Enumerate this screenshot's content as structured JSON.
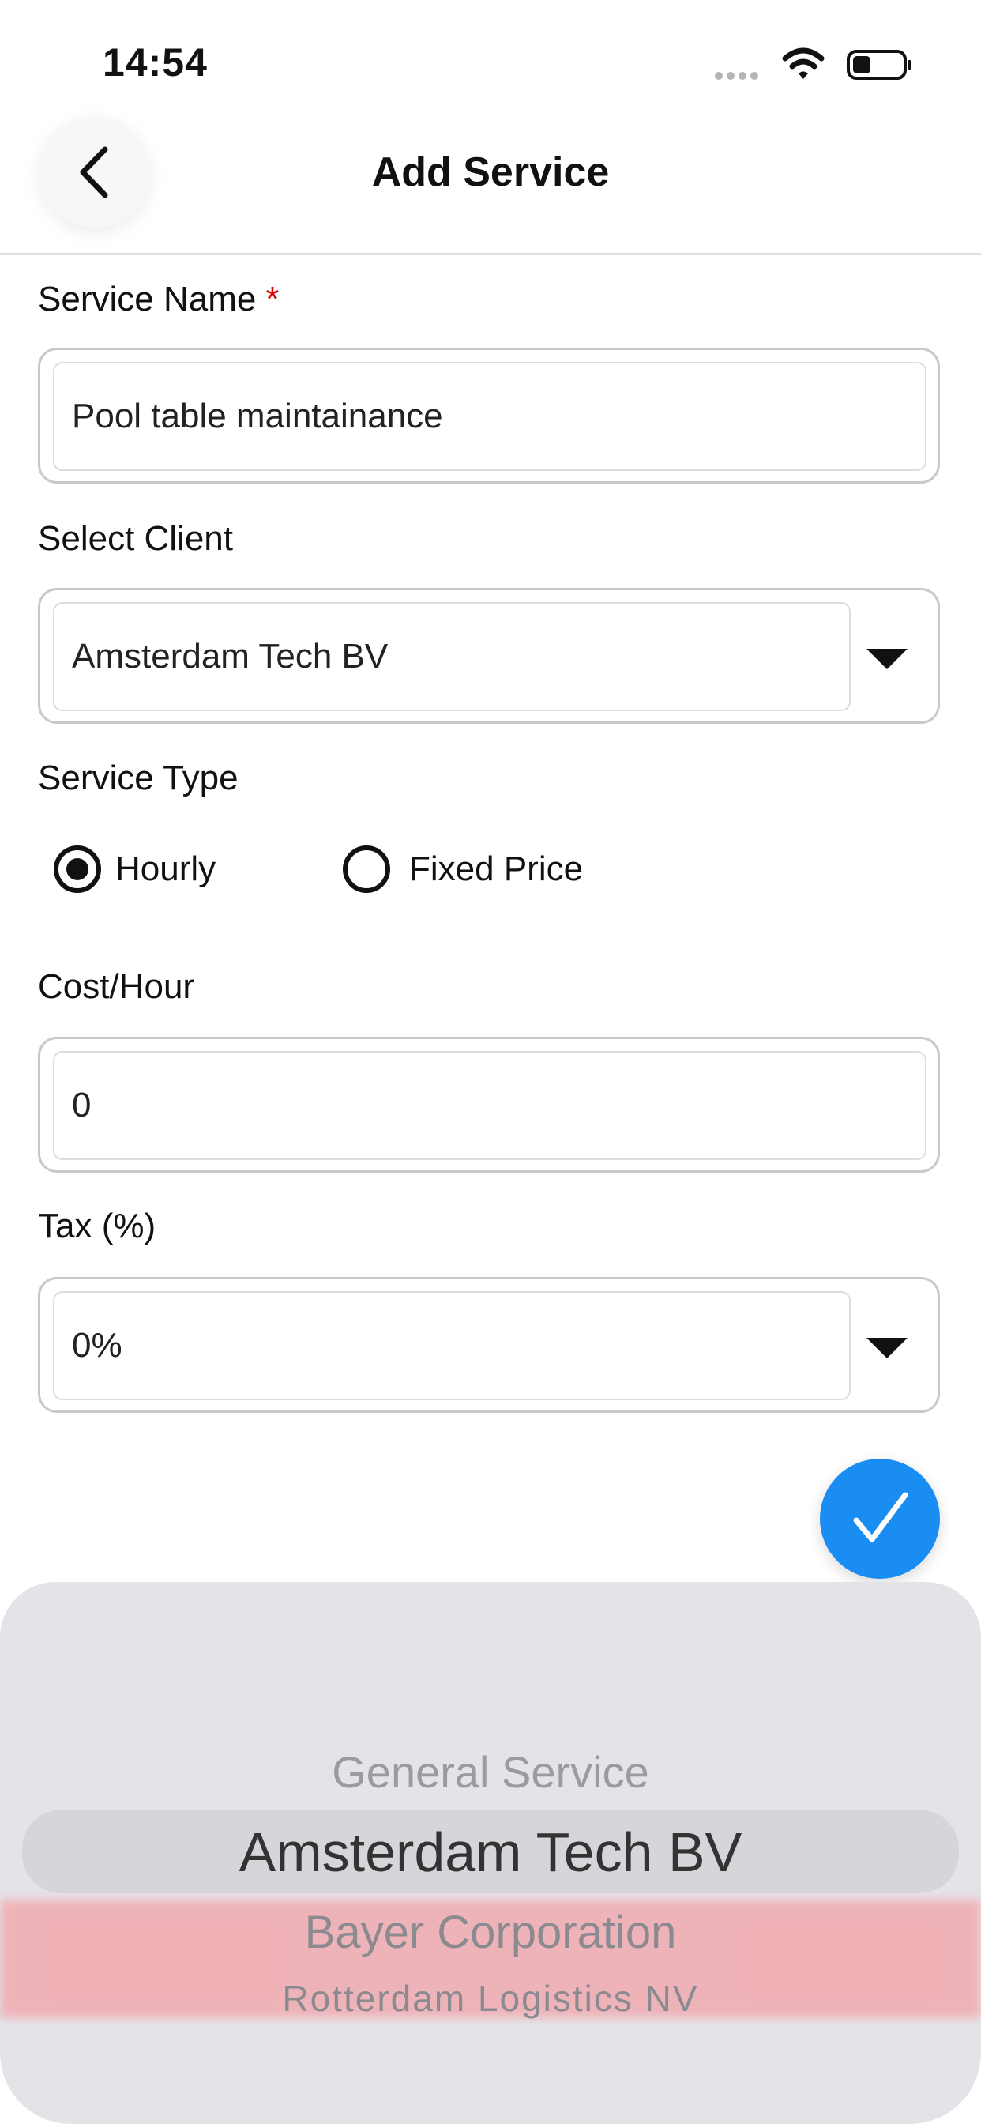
{
  "status_bar": {
    "time": "14:54"
  },
  "header": {
    "title": "Add Service"
  },
  "form": {
    "service_name": {
      "label": "Service Name",
      "required_mark": "*",
      "value": "Pool table maintainance"
    },
    "client": {
      "label": "Select Client",
      "value": "Amsterdam Tech BV"
    },
    "service_type": {
      "label": "Service Type",
      "options": [
        {
          "label": "Hourly",
          "selected": true
        },
        {
          "label": "Fixed Price",
          "selected": false
        }
      ]
    },
    "cost": {
      "label": "Cost/Hour",
      "value": "0"
    },
    "tax": {
      "label": "Tax (%)",
      "value": "0%"
    }
  },
  "picker": {
    "items": [
      "General Service",
      "Amsterdam Tech BV",
      "Bayer Corporation",
      "Rotterdam Logistics NV"
    ],
    "selected_index": 1
  },
  "colors": {
    "accent": "#1a8df2",
    "required": "#e00000"
  }
}
